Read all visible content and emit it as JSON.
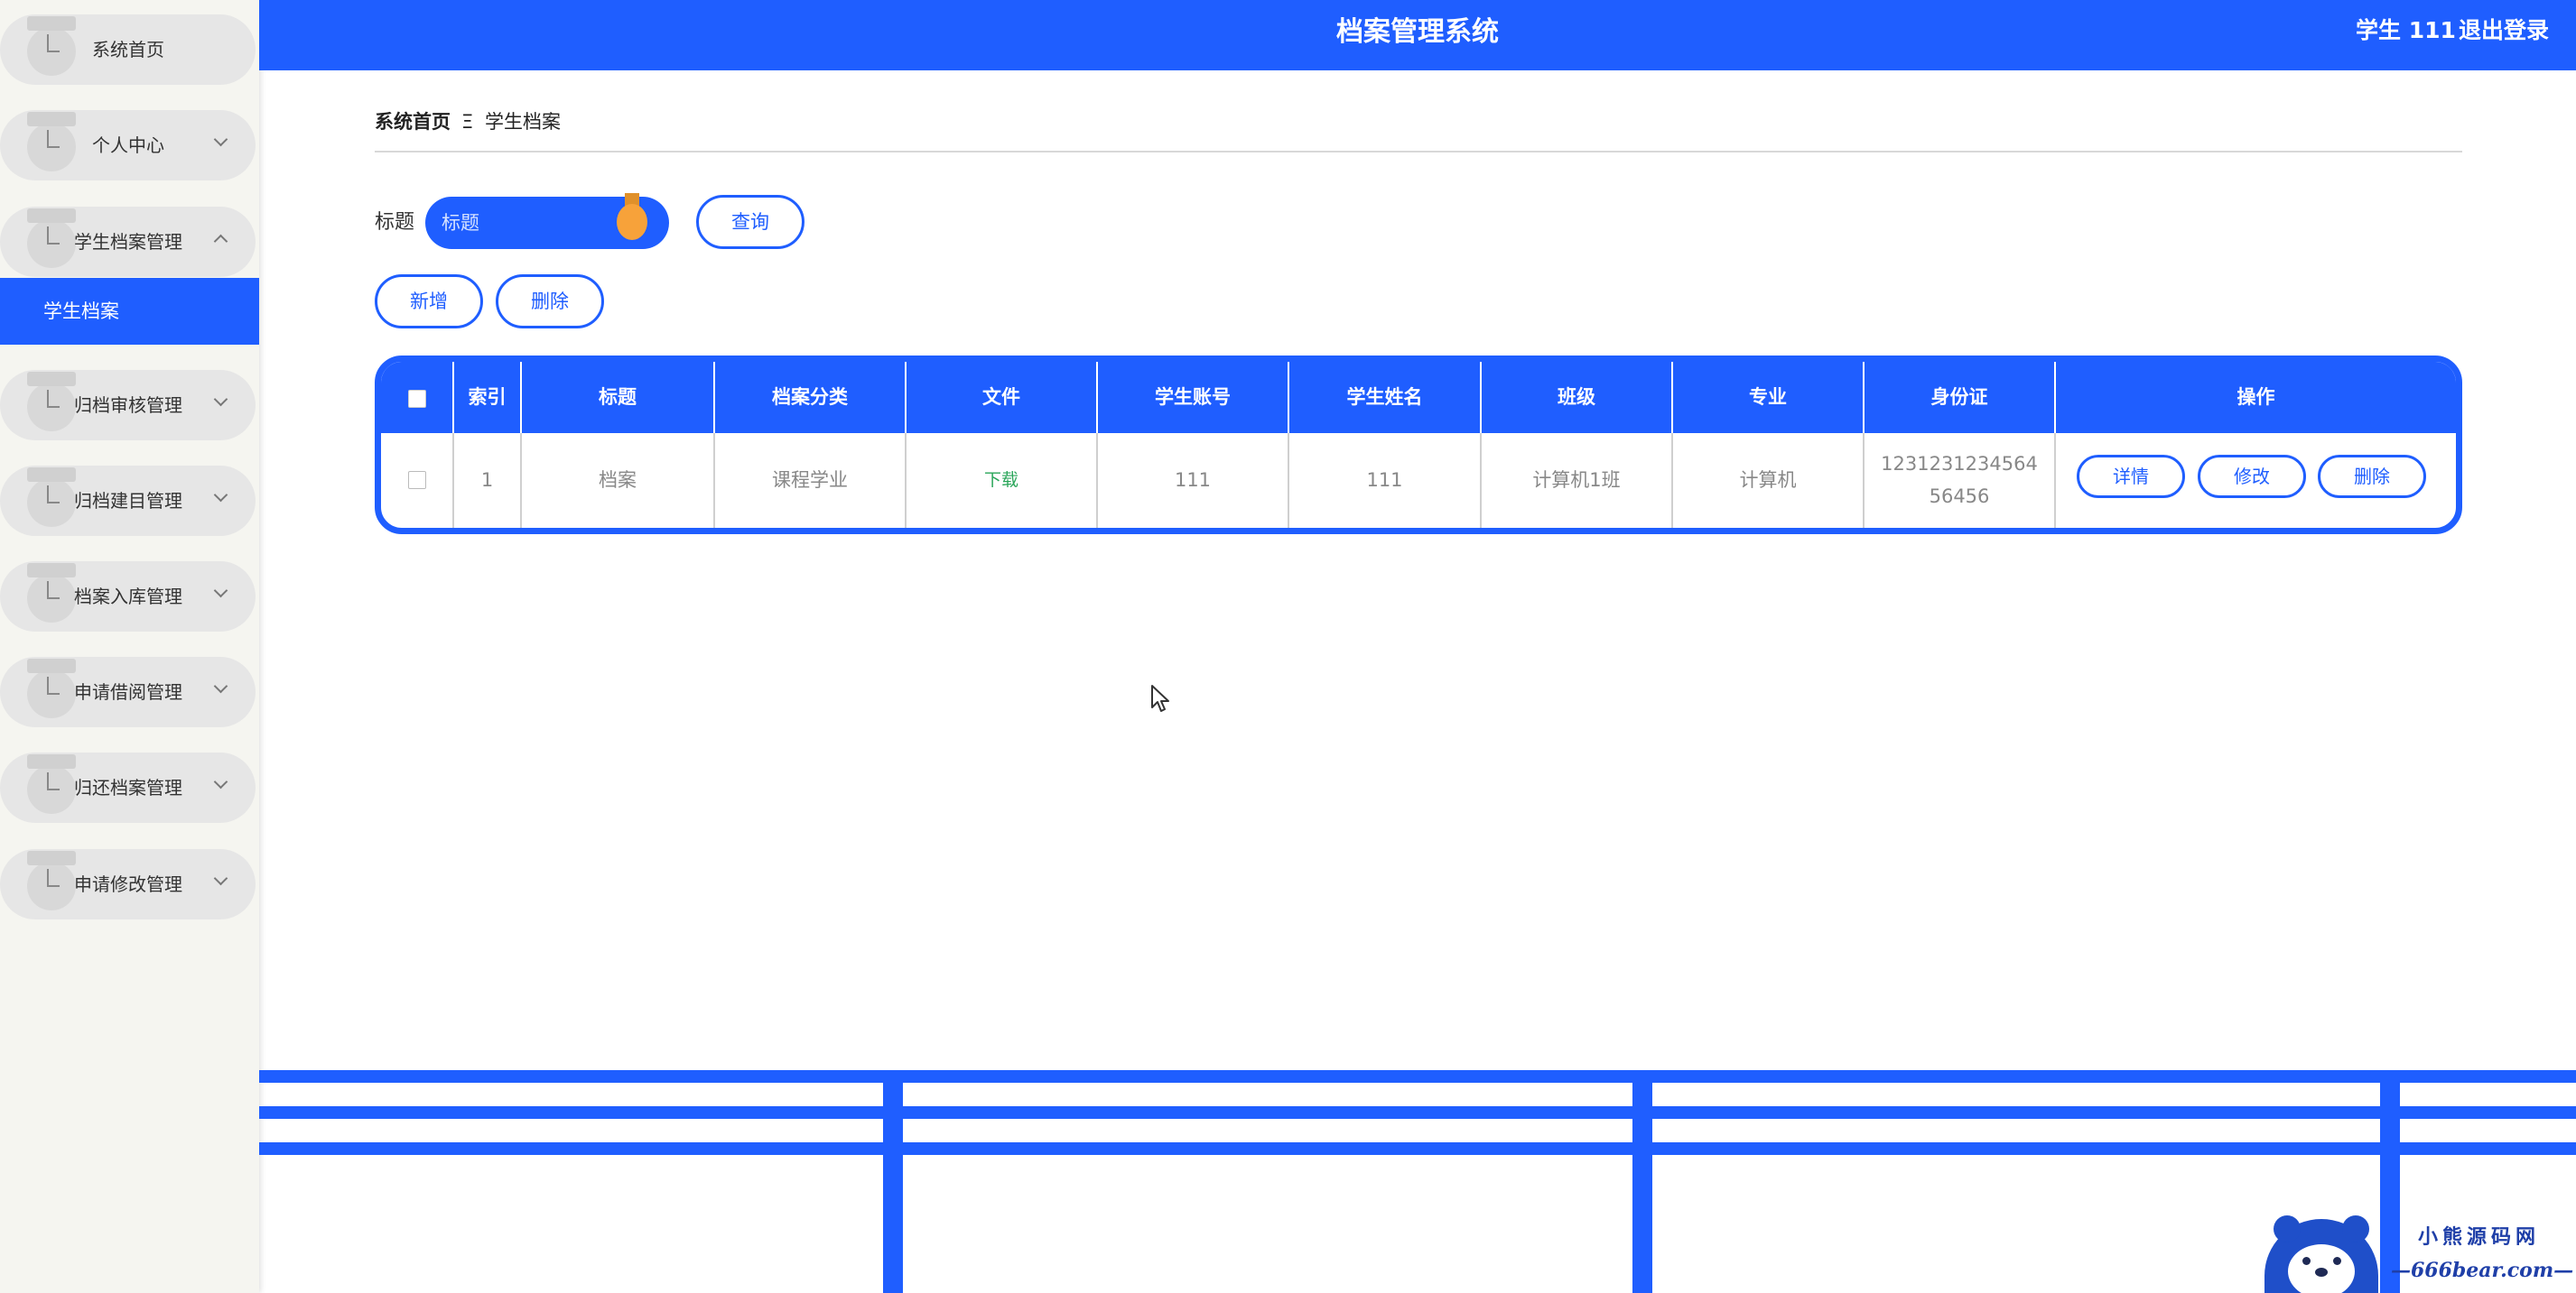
{
  "header": {
    "title": "档案管理系统",
    "user": "学生 111",
    "logout": "退出登录"
  },
  "sidebar": {
    "items": [
      {
        "label": "系统首页",
        "chevron": "none"
      },
      {
        "label": "个人中心",
        "chevron": "down"
      },
      {
        "label": "学生档案管理",
        "chevron": "up"
      },
      {
        "label": "归档审核管理",
        "chevron": "down"
      },
      {
        "label": "归档建目管理",
        "chevron": "down"
      },
      {
        "label": "档案入库管理",
        "chevron": "down"
      },
      {
        "label": "申请借阅管理",
        "chevron": "down"
      },
      {
        "label": "归还档案管理",
        "chevron": "down"
      },
      {
        "label": "申请修改管理",
        "chevron": "down"
      }
    ],
    "active_sub": "学生档案"
  },
  "breadcrumb": {
    "home": "系统首页",
    "separator": "Ξ",
    "current": "学生档案"
  },
  "search": {
    "label": "标题",
    "placeholder": "标题",
    "query_button": "查询"
  },
  "actions": {
    "add": "新增",
    "delete": "删除"
  },
  "table": {
    "headers": [
      "索引",
      "标题",
      "档案分类",
      "文件",
      "学生账号",
      "学生姓名",
      "班级",
      "专业",
      "身份证",
      "操作"
    ],
    "rows": [
      {
        "index": "1",
        "title": "档案",
        "category": "课程学业",
        "file": "下载",
        "account": "111",
        "name": "111",
        "class": "计算机1班",
        "major": "计算机",
        "id_card": "123123123456456456",
        "ops": {
          "detail": "详情",
          "edit": "修改",
          "delete": "删除"
        }
      }
    ]
  },
  "watermark": {
    "line1": "小熊源码网",
    "line2": "—666bear.com—"
  },
  "colors": {
    "primary": "#1f5eff",
    "medal": "#f7a23a",
    "link": "#2aa65a"
  },
  "icons": {
    "menu": "folder-icon",
    "chevron": "chevron-icon",
    "medal": "medal-icon",
    "cursor": "cursor-icon"
  }
}
